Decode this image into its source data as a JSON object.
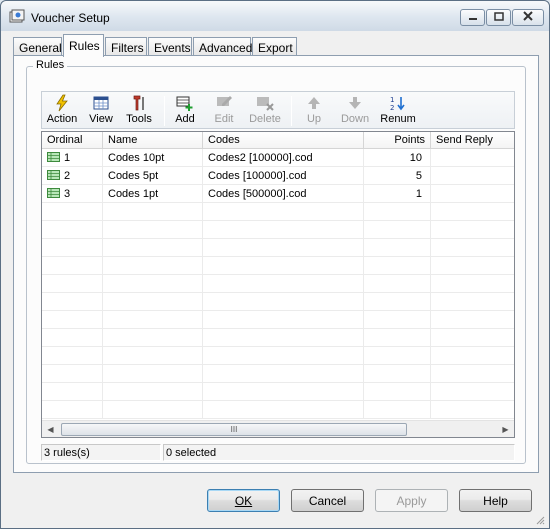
{
  "window": {
    "title": "Voucher Setup"
  },
  "tabs": [
    {
      "label": "General"
    },
    {
      "label": "Rules"
    },
    {
      "label": "Filters"
    },
    {
      "label": "Events"
    },
    {
      "label": "Advanced"
    },
    {
      "label": "Export"
    }
  ],
  "active_tab": "Rules",
  "group": {
    "label": "Rules"
  },
  "toolbar": {
    "items": [
      {
        "label": "Action",
        "icon": "lightning-icon",
        "enabled": true
      },
      {
        "label": "View",
        "icon": "grid-view-icon",
        "enabled": true
      },
      {
        "label": "Tools",
        "icon": "tools-icon",
        "enabled": true
      },
      {
        "label": "Add",
        "icon": "add-row-icon",
        "enabled": true
      },
      {
        "label": "Edit",
        "icon": "edit-icon",
        "enabled": false
      },
      {
        "label": "Delete",
        "icon": "delete-icon",
        "enabled": false
      },
      {
        "label": "Up",
        "icon": "arrow-up-icon",
        "enabled": false
      },
      {
        "label": "Down",
        "icon": "arrow-down-icon",
        "enabled": false
      },
      {
        "label": "Renum",
        "icon": "renumber-icon",
        "enabled": true
      }
    ]
  },
  "grid": {
    "columns": [
      "Ordinal",
      "Name",
      "Codes",
      "Points",
      "Send Reply"
    ],
    "rows": [
      {
        "ordinal": "1",
        "name": "Codes 10pt",
        "codes": "Codes2 [100000].cod",
        "points": "10",
        "send_reply": ""
      },
      {
        "ordinal": "2",
        "name": "Codes 5pt",
        "codes": "Codes [100000].cod",
        "points": "5",
        "send_reply": ""
      },
      {
        "ordinal": "3",
        "name": "Codes 1pt",
        "codes": "Codes [500000].cod",
        "points": "1",
        "send_reply": ""
      }
    ],
    "scroll_thumb_glyph": "III"
  },
  "status": {
    "count": "3 rules(s)",
    "selected": "0 selected"
  },
  "buttons": {
    "ok": "OK",
    "cancel": "Cancel",
    "apply": "Apply",
    "help": "Help"
  },
  "colors": {
    "row_icon": "#3d8a3d",
    "action_icon": "#f2c200",
    "tools_icon": "#c0392b"
  }
}
